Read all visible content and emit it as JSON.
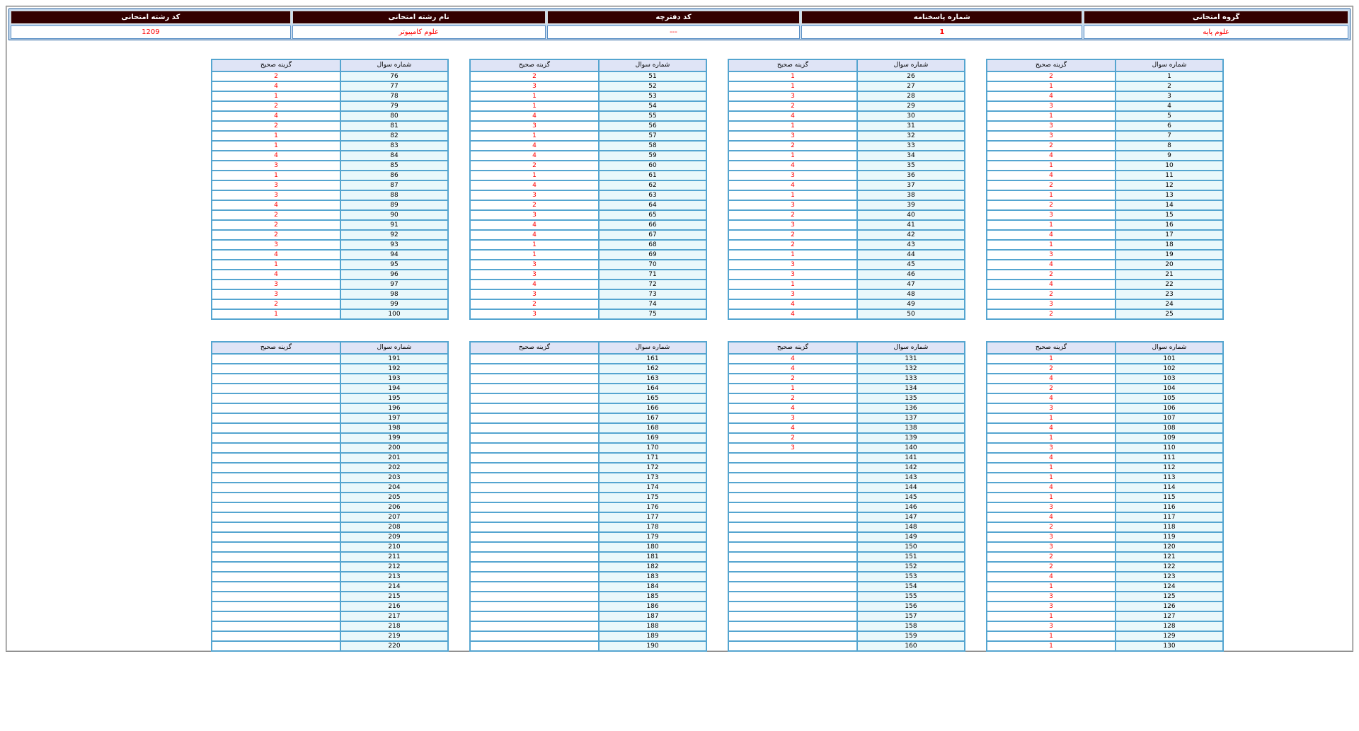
{
  "header": {
    "labels": [
      "گروه امتحانی",
      "شماره پاسخنامه",
      "کد دفترچه",
      "نام رشته امتحانی",
      "کد رشته امتحانی"
    ],
    "values": [
      "علوم پایه",
      "1",
      "---",
      "علوم کامپیوتر",
      "1209"
    ]
  },
  "columns": {
    "answer": "گزینه صحیح",
    "question": "شماره سوال"
  },
  "answers": [
    2,
    1,
    4,
    3,
    1,
    3,
    3,
    2,
    4,
    1,
    4,
    2,
    1,
    2,
    3,
    1,
    4,
    1,
    3,
    4,
    2,
    4,
    2,
    3,
    2,
    1,
    1,
    3,
    2,
    4,
    1,
    3,
    2,
    1,
    4,
    3,
    4,
    1,
    3,
    2,
    3,
    2,
    2,
    1,
    3,
    3,
    1,
    3,
    4,
    4,
    2,
    3,
    1,
    1,
    4,
    3,
    1,
    4,
    4,
    2,
    1,
    4,
    3,
    2,
    3,
    4,
    4,
    1,
    1,
    3,
    3,
    4,
    3,
    2,
    3,
    2,
    4,
    1,
    2,
    4,
    2,
    1,
    1,
    4,
    3,
    1,
    3,
    3,
    4,
    2,
    2,
    2,
    3,
    4,
    1,
    4,
    3,
    3,
    2,
    1,
    1,
    2,
    4,
    2,
    4,
    3,
    1,
    4,
    1,
    3,
    4,
    1,
    1,
    4,
    1,
    3,
    4,
    2,
    3,
    3,
    2,
    2,
    4,
    1,
    3,
    3,
    1,
    3,
    1,
    1,
    4,
    4,
    2,
    1,
    2,
    4,
    3,
    4,
    2,
    3
  ],
  "total_questions": 220
}
